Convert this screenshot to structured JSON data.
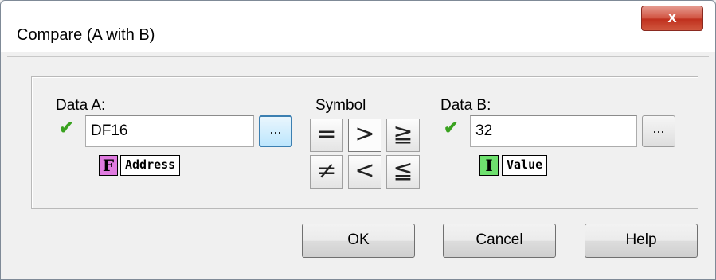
{
  "window": {
    "title": "Compare (A with B)",
    "close_glyph": "x"
  },
  "data_a": {
    "label": "Data A:",
    "value": "DF16",
    "browse_label": "...",
    "type_badge": "F",
    "type_badge_color": "#e07be0",
    "type_text": "Address",
    "valid_icon": "check-icon"
  },
  "symbol": {
    "label": "Symbol",
    "buttons": [
      "=",
      ">",
      "≧",
      "≠",
      "<",
      "≦"
    ],
    "selected": ">"
  },
  "data_b": {
    "label": "Data B:",
    "value": "32",
    "browse_label": "...",
    "type_badge": "I",
    "type_badge_color": "#6ee06e",
    "type_text": "Value",
    "valid_icon": "check-icon"
  },
  "buttons": {
    "ok": "OK",
    "cancel": "Cancel",
    "help": "Help"
  }
}
